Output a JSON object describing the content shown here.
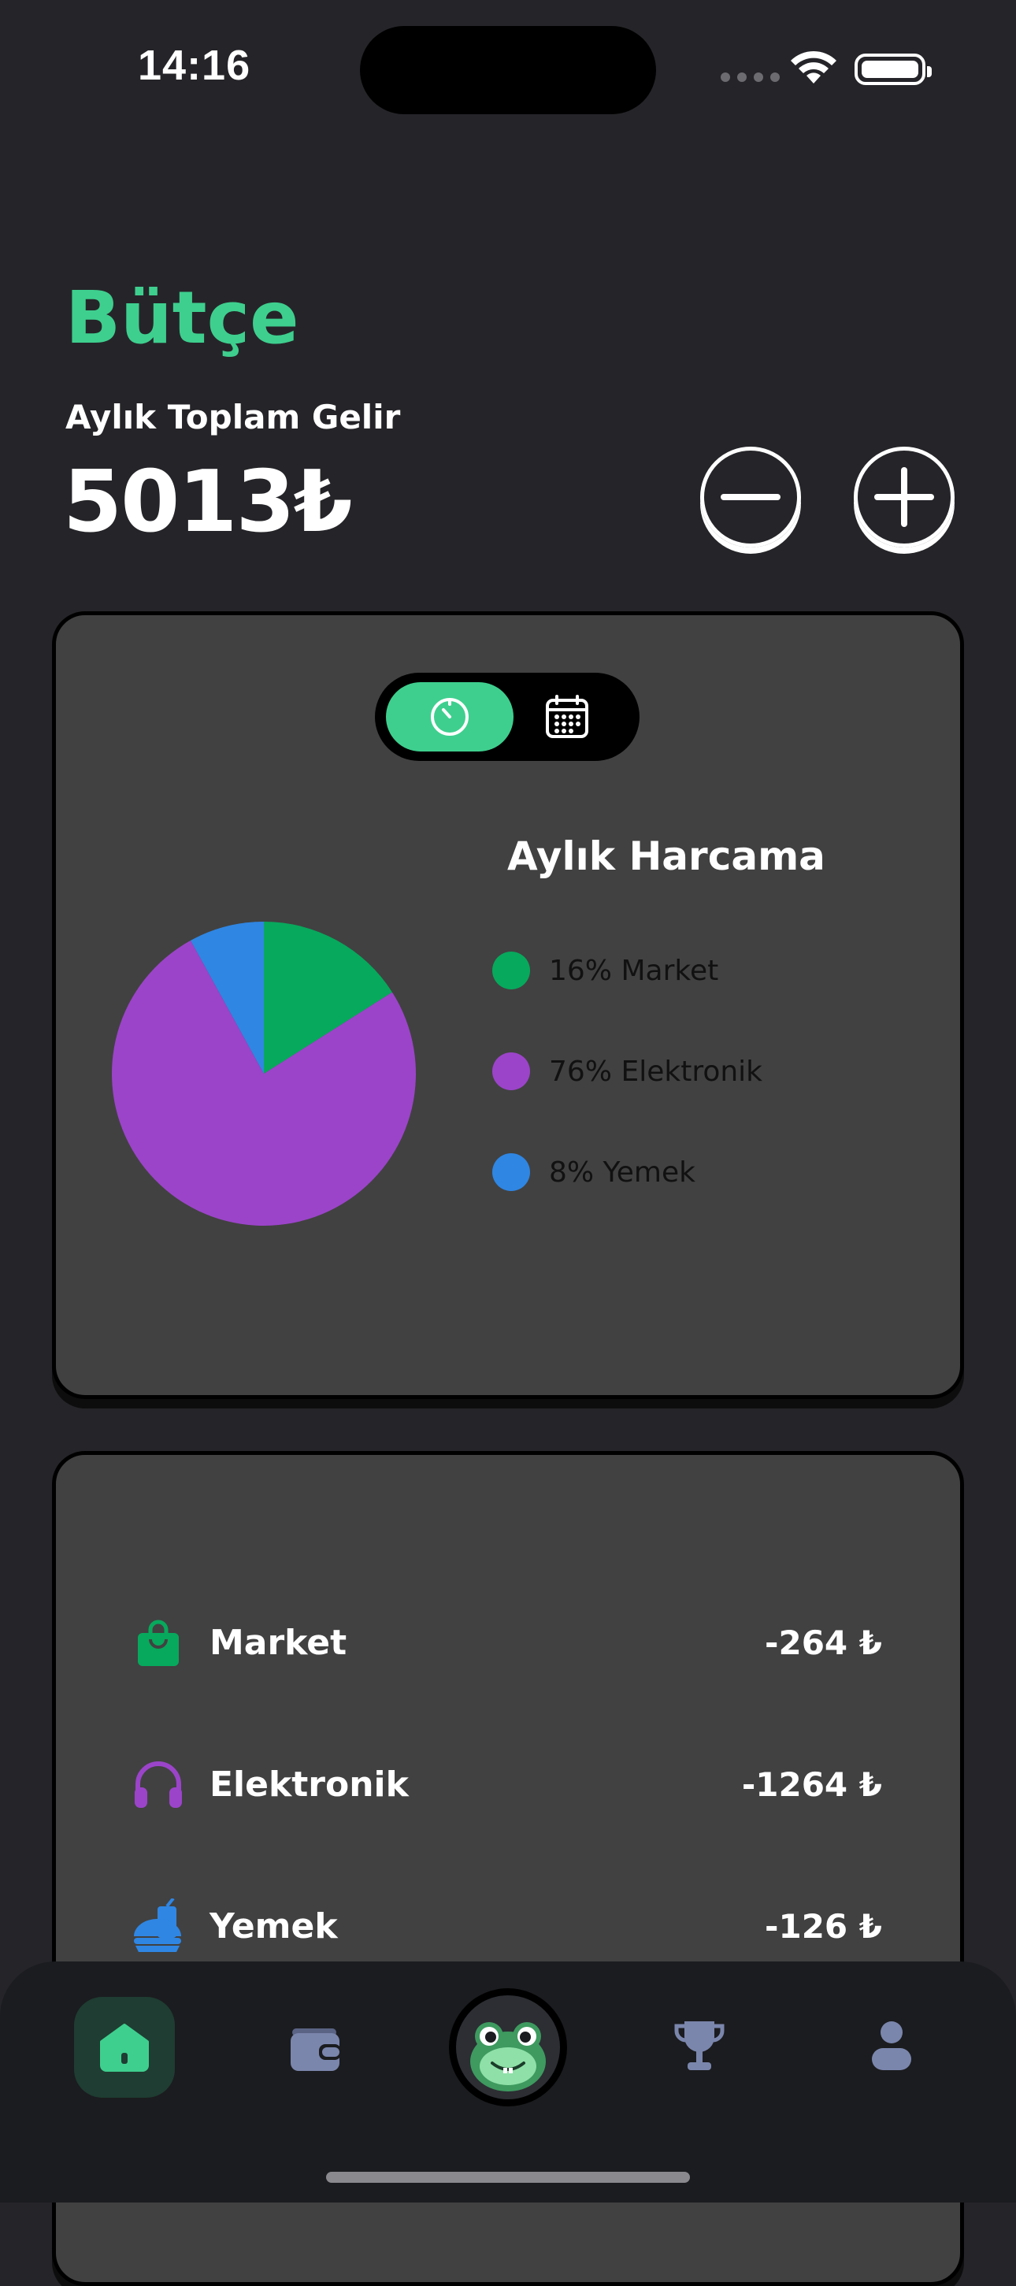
{
  "status_bar": {
    "time": "14:16"
  },
  "header": {
    "title": "Bütçe",
    "income_label": "Aylık Toplam Gelir",
    "income_value": "5013₺"
  },
  "actions": {
    "subtract_icon": "minus-icon",
    "add_icon": "plus-icon"
  },
  "view_toggle": {
    "options": [
      "timer-icon",
      "calendar-icon"
    ],
    "selected": "timer-icon"
  },
  "chart_data": {
    "type": "pie",
    "title": "Aylık Harcama",
    "slices": [
      {
        "label": "Market",
        "value": 16,
        "color": "#07a95c"
      },
      {
        "label": "Elektronik",
        "value": 76,
        "color": "#9b44c9"
      },
      {
        "label": "Yemek",
        "value": 8,
        "color": "#2f86e3"
      }
    ],
    "legend": [
      "16% Market",
      "76% Elektronik",
      "8% Yemek"
    ],
    "legend_placement": "right"
  },
  "categories": [
    {
      "name": "Market",
      "amount": "-264 ₺",
      "icon": "shopping-bag-icon",
      "color": "#07a95c"
    },
    {
      "name": "Elektronik",
      "amount": "-1264 ₺",
      "icon": "headphones-icon",
      "color": "#9b44c9"
    },
    {
      "name": "Yemek",
      "amount": "-126 ₺",
      "icon": "food-icon",
      "color": "#2f86e3"
    }
  ],
  "nav": {
    "items": [
      "home-icon",
      "wallet-icon",
      "frog-mascot-icon",
      "trophy-icon",
      "profile-icon"
    ],
    "active": "home-icon",
    "accent": "#3ecf8e",
    "inactive_color": "#7b86ad"
  }
}
